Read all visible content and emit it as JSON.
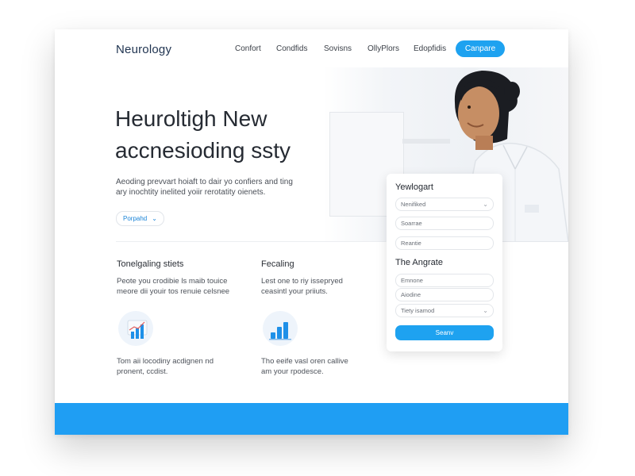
{
  "nav": {
    "logo": "Neurology",
    "links": [
      "Confort",
      "Condfids",
      "Sovisns",
      "OllyPlors",
      "Edopfidis"
    ],
    "cta": "Canpare"
  },
  "hero": {
    "title_line1": "Heuroltigh New",
    "title_line2": "accnesioding ssty",
    "sub_line1": "Aeoding prevvart hoiaft to dair yo confiers and ting",
    "sub_line2": "ary inochtity inelited yoiir rerotatity oienets.",
    "pill_label": "Porpahd"
  },
  "features": [
    {
      "title": "Tonelgaling stiets",
      "desc_line1": "Peote you crodibie ls maib touice",
      "desc_line2": "meore dii youir tos renuie celsnee",
      "caption_line1": "Tom aii locodiny acdignen nd",
      "caption_line2": "pronent, ccdist."
    },
    {
      "title": "Fecaling",
      "desc_line1": "Lest one to riy issepryed",
      "desc_line2": "ceasintl your priiuts.",
      "caption_line1": "Tho eeife vasl oren callive",
      "caption_line2": "am your rpodesce."
    }
  ],
  "form": {
    "heading1": "Yewlogart",
    "field1": "Nenifiked",
    "field2": "Soarrae",
    "field3": "Reantie",
    "heading2": "The Angrate",
    "field4": "Emnone",
    "field5": "Aiodine",
    "field6": "Tiety isamod",
    "submit": "Seanv"
  },
  "colors": {
    "accent": "#1ea2f0",
    "footer": "#1f9ef3",
    "logo": "#1f3350"
  },
  "icons": [
    "chevron-down-icon",
    "chart-icon",
    "bar-chart-icon"
  ]
}
